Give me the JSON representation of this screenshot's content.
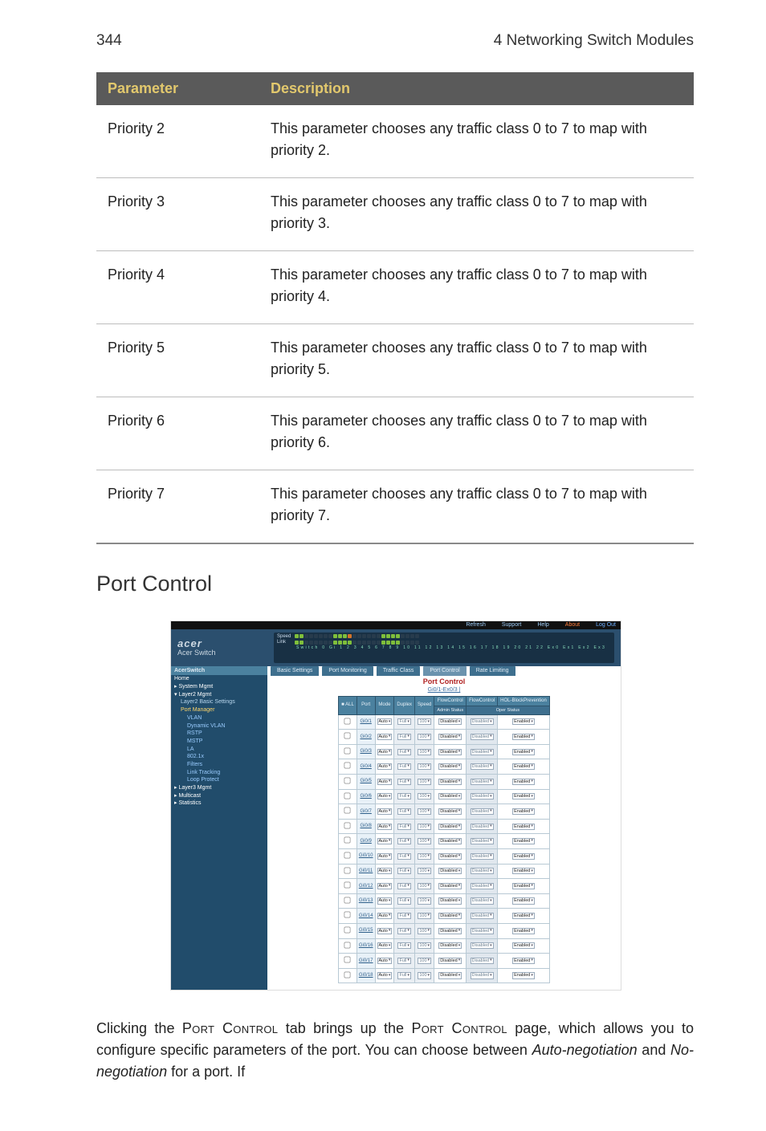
{
  "header": {
    "page_number": "344",
    "chapter_title": "4 Networking Switch Modules"
  },
  "param_table": {
    "head": {
      "param": "Parameter",
      "desc": "Description"
    },
    "rows": [
      {
        "name": "Priority 2",
        "desc": "This parameter chooses any traffic class 0 to 7 to map with priority 2."
      },
      {
        "name": "Priority 3",
        "desc": "This parameter chooses any traffic class 0 to 7 to map with priority 3."
      },
      {
        "name": "Priority 4",
        "desc": "This parameter chooses any traffic class 0 to 7 to map with priority 4."
      },
      {
        "name": "Priority 5",
        "desc": "This parameter chooses any traffic class 0 to 7 to map with priority 5."
      },
      {
        "name": "Priority 6",
        "desc": "This parameter chooses any traffic class 0 to 7 to map with priority 6."
      },
      {
        "name": "Priority 7",
        "desc": "This parameter chooses any traffic class 0 to 7 to map with priority 7."
      }
    ]
  },
  "section_title": "Port Control",
  "screenshot": {
    "topbar": [
      "Refresh",
      "Support",
      "Help",
      "About",
      "Log Out"
    ],
    "brand": {
      "logo": "acer",
      "sub": "Acer Switch"
    },
    "panel": {
      "speed_label": "Speed",
      "link_label": "Link",
      "numbers": "Switch 0 Gi 1 2 3 4 5 6 7 8 9 10 11 12 13 14 15 16 17 18 19 20 21 22 Ex0 Ex1 Ex2 Ex3"
    },
    "nav": {
      "header": "AcerSwitch",
      "items": [
        {
          "label": "Home",
          "cls": "row emph"
        },
        {
          "label": "▸ System Mgmt",
          "cls": "row emph"
        },
        {
          "label": "▾ Layer2 Mgmt",
          "cls": "row emph"
        },
        {
          "label": "Layer2 Basic Settings",
          "cls": "row sub"
        },
        {
          "label": "Port Manager",
          "cls": "row sub sel"
        },
        {
          "label": "VLAN",
          "cls": "row sub2"
        },
        {
          "label": "Dynamic VLAN",
          "cls": "row sub2"
        },
        {
          "label": "RSTP",
          "cls": "row sub2"
        },
        {
          "label": "MSTP",
          "cls": "row sub2"
        },
        {
          "label": "LA",
          "cls": "row sub2"
        },
        {
          "label": "802.1x",
          "cls": "row sub2"
        },
        {
          "label": "Filters",
          "cls": "row sub2"
        },
        {
          "label": "Link Tracking",
          "cls": "row sub2"
        },
        {
          "label": "Loop Protect",
          "cls": "row sub2"
        },
        {
          "label": "▸ Layer3 Mgmt",
          "cls": "row emph"
        },
        {
          "label": "▸ Multicast",
          "cls": "row emph"
        },
        {
          "label": "▸ Statistics",
          "cls": "row emph"
        }
      ]
    },
    "tabs": [
      "Basic Settings",
      "Port Monitoring",
      "Traffic Class",
      "Port Control",
      "Rate Limiting"
    ],
    "active_tab_index": 3,
    "main": {
      "title": "Port Control",
      "sub": "Gi0/1-Ex0/3 |",
      "columns": {
        "all": "■ ALL",
        "port": "Port",
        "mode": "Mode",
        "duplex": "Duplex",
        "speed": "Speed",
        "fc1": "FlowControl",
        "fc2": "FlowControl",
        "hol": "HOL-BlockPrevention",
        "sub1": "Admin Status",
        "sub2": "Oper Status"
      },
      "opt": {
        "auto": "Auto",
        "full": "Full",
        "hund": "100",
        "disabled": "Disabled",
        "enabled": "Enabled"
      },
      "ports": [
        "Gi0/1",
        "Gi0/2",
        "Gi0/3",
        "Gi0/4",
        "Gi0/5",
        "Gi0/6",
        "Gi0/7",
        "Gi0/8",
        "Gi0/9",
        "Gi0/10",
        "Gi0/11",
        "Gi0/12",
        "Gi0/13",
        "Gi0/14",
        "Gi0/15",
        "Gi0/16",
        "Gi0/17",
        "Gi0/18"
      ]
    }
  },
  "body_text": {
    "p1_a": "Clicking the ",
    "p1_sc1": "Port Control",
    "p1_b": " tab brings up the ",
    "p1_sc2": "Port Control",
    "p1_c": " page, which allows you to configure specific parameters of the port. You can choose between ",
    "p1_em1": "Auto-negotiation",
    "p1_d": " and ",
    "p1_em2": "No-negotiation",
    "p1_e": " for a port. If"
  }
}
